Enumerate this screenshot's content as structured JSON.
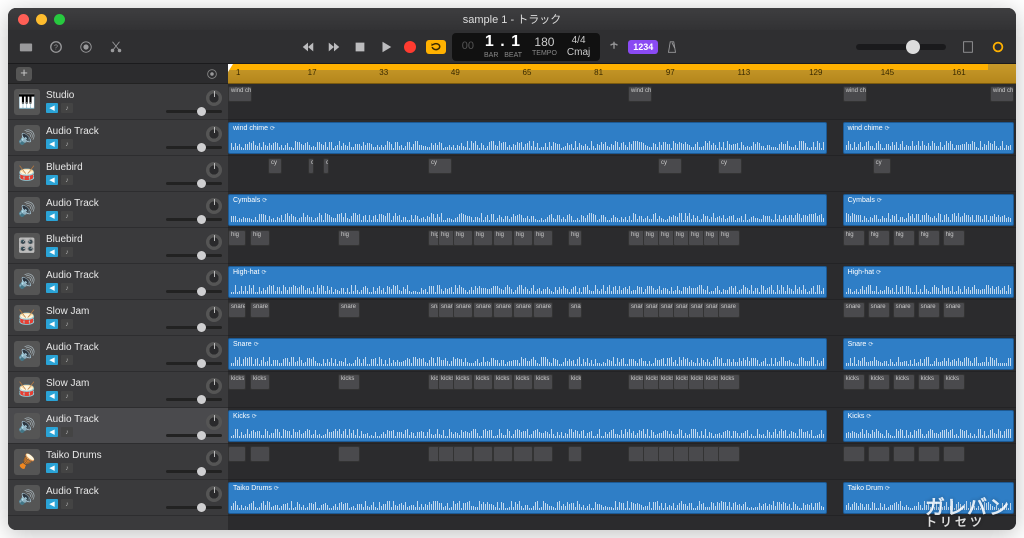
{
  "window": {
    "title": "sample 1 - トラック"
  },
  "toolbar": {
    "lcd": {
      "bar_dim": "00",
      "bar_beat": "1 . 1",
      "bar_label": "BAR",
      "beat_label": "BEAT",
      "tempo": "180",
      "tempo_label": "TEMPO",
      "sig": "4/4",
      "key": "Cmaj"
    },
    "chip": "1234"
  },
  "ruler_bars": [
    "1",
    "17",
    "33",
    "49",
    "65",
    "81",
    "97",
    "113",
    "129",
    "145",
    "161"
  ],
  "tracks": [
    {
      "name": "Studio",
      "icon": "🎹",
      "mute": true
    },
    {
      "name": "Audio Track",
      "icon": "🔊",
      "mute": true
    },
    {
      "name": "Bluebird",
      "icon": "🥁",
      "mute": true
    },
    {
      "name": "Audio Track",
      "icon": "🔊",
      "mute": true
    },
    {
      "name": "Bluebird",
      "icon": "🎛️",
      "mute": true
    },
    {
      "name": "Audio Track",
      "icon": "🔊",
      "mute": true
    },
    {
      "name": "Slow Jam",
      "icon": "🥁",
      "mute": true
    },
    {
      "name": "Audio Track",
      "icon": "🔊",
      "mute": true
    },
    {
      "name": "Slow Jam",
      "icon": "🥁",
      "mute": true
    },
    {
      "name": "Audio Track",
      "icon": "🔊",
      "mute": true,
      "selected": true
    },
    {
      "name": "Taiko Drums",
      "icon": "🪘",
      "mute": true
    },
    {
      "name": "Audio Track",
      "icon": "🔊",
      "mute": false
    }
  ],
  "rows": [
    {
      "type": "midi",
      "label_short": "wind ch"
    },
    {
      "type": "audio",
      "label": "wind chime",
      "label2": "wind chime"
    },
    {
      "type": "midi",
      "label_short": "cy"
    },
    {
      "type": "audio",
      "label": "Cymbals",
      "label2": "Cymbals"
    },
    {
      "type": "midi",
      "label_short": "high hat",
      "piece": "hig"
    },
    {
      "type": "audio",
      "label": "High-hat",
      "label2": "High-hat"
    },
    {
      "type": "midi",
      "label_short": "snare",
      "piece": "snare"
    },
    {
      "type": "audio",
      "label": "Snare",
      "label2": "Snare"
    },
    {
      "type": "midi",
      "label_short": "kicks",
      "piece": "kicks"
    },
    {
      "type": "audio",
      "label": "Kicks",
      "label2": "Kicks"
    },
    {
      "type": "midi",
      "label_short": ""
    },
    {
      "type": "audio",
      "label": "Taiko Drums",
      "label2": "Taiko Drum"
    }
  ],
  "watermark": {
    "line1": "ガレバン",
    "line2": "トリセツ"
  }
}
